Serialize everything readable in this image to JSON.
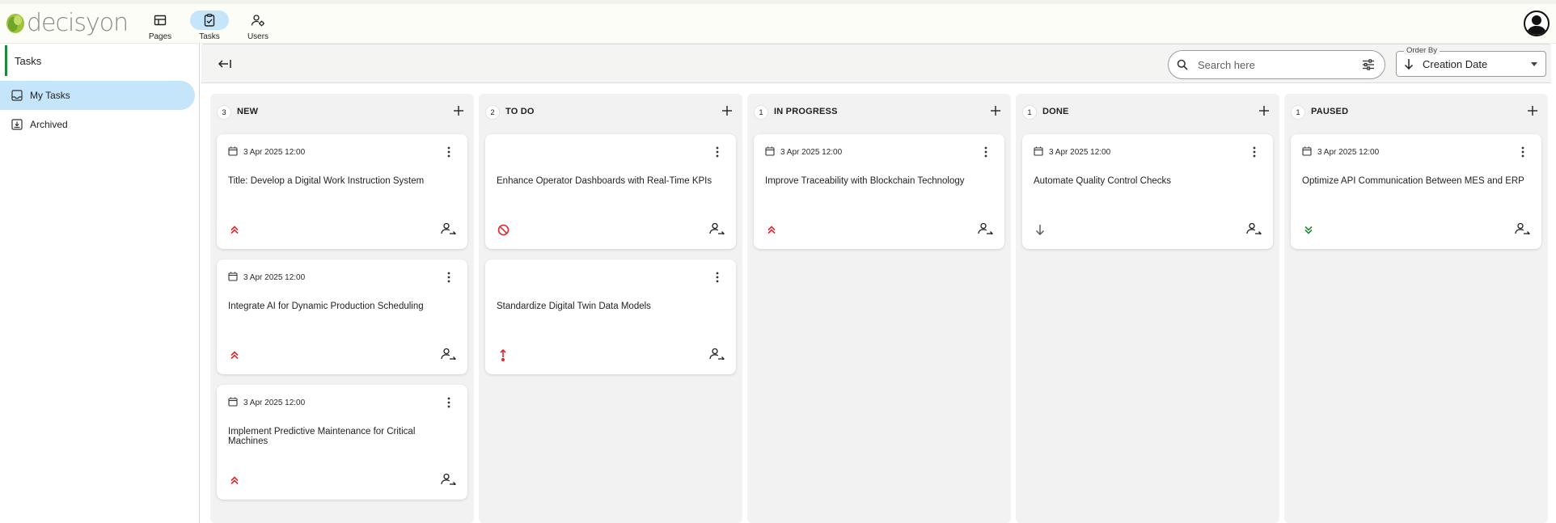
{
  "app": {
    "logo_text": "decisyon",
    "nav": [
      {
        "label": "Pages",
        "icon": "pages-grid-icon"
      },
      {
        "label": "Tasks",
        "icon": "tasks-checklist-icon"
      },
      {
        "label": "Users",
        "icon": "users-settings-icon"
      }
    ],
    "active_nav": "Tasks"
  },
  "sidebar": {
    "title": "Tasks",
    "items": [
      {
        "label": "My Tasks",
        "icon": "inbox-icon",
        "active": true
      },
      {
        "label": "Archived",
        "icon": "archive-icon",
        "active": false
      }
    ]
  },
  "toolbar": {
    "search_placeholder": "Search here",
    "order_by_label": "Order By",
    "order_by_value": "Creation Date",
    "order_direction": "descending"
  },
  "colors": {
    "accent_blue": "#c5e5fb",
    "accent_green": "#1d8a3a",
    "priority_red": "#e0282e",
    "priority_green": "#1d8a3a",
    "column_bg": "#f2f2f2"
  },
  "columns": [
    {
      "count": "3",
      "title": "NEW",
      "cards": [
        {
          "date": "3 Apr 2025 12:00",
          "title": "Title: Develop a Digital Work Instruction System",
          "priority": "high"
        },
        {
          "date": "3 Apr 2025 12:00",
          "title": "Integrate AI for Dynamic Production Scheduling",
          "priority": "high"
        },
        {
          "date": "3 Apr 2025 12:00",
          "title": "Implement Predictive Maintenance for Critical Machines",
          "priority": "high"
        }
      ]
    },
    {
      "count": "2",
      "title": "TO DO",
      "cards": [
        {
          "date": "",
          "title": "Enhance Operator Dashboards with Real-Time KPIs",
          "priority": "blocked"
        },
        {
          "date": "",
          "title": "Standardize Digital Twin Data Models",
          "priority": "urgent"
        }
      ]
    },
    {
      "count": "1",
      "title": "IN PROGRESS",
      "cards": [
        {
          "date": "3 Apr 2025 12:00",
          "title": "Improve Traceability with Blockchain Technology",
          "priority": "high"
        }
      ]
    },
    {
      "count": "1",
      "title": "DONE",
      "cards": [
        {
          "date": "3 Apr 2025 12:00",
          "title": "Automate Quality Control Checks",
          "priority": "low"
        }
      ]
    },
    {
      "count": "1",
      "title": "PAUSED",
      "cards": [
        {
          "date": "3 Apr 2025 12:00",
          "title": "Optimize API Communication Between MES and ERP",
          "priority": "lowest"
        }
      ]
    }
  ]
}
